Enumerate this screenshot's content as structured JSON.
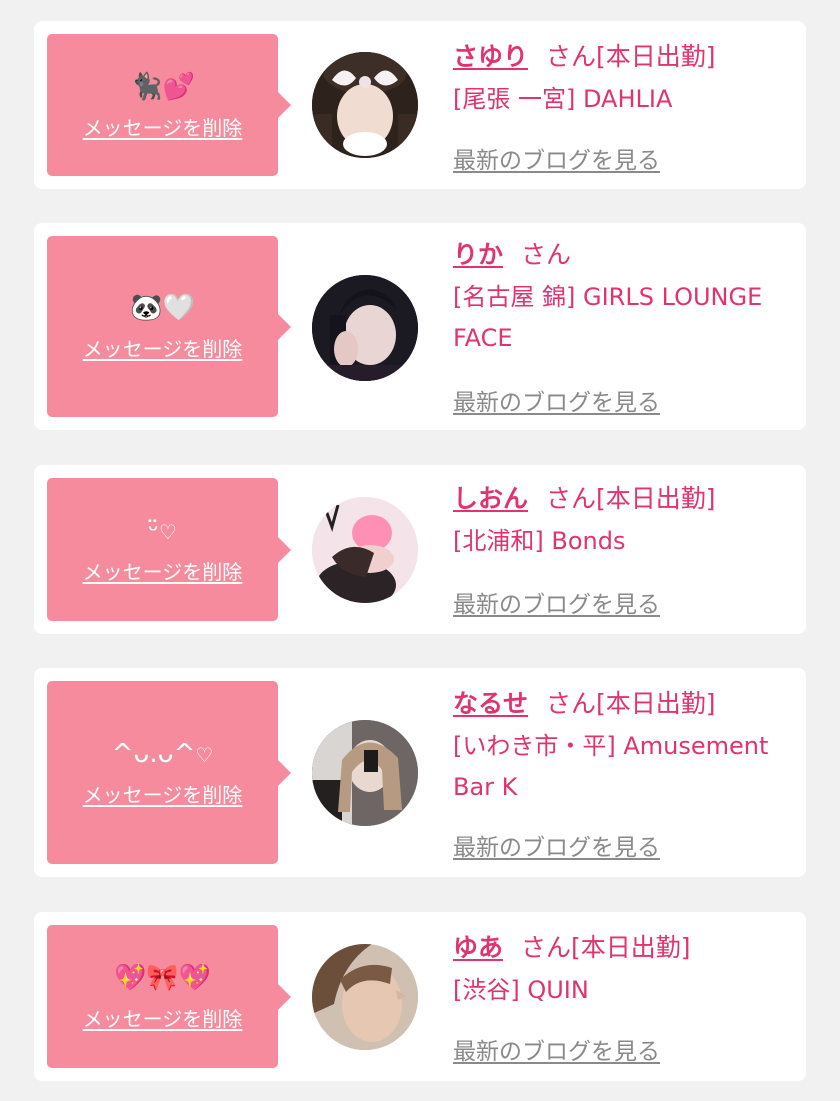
{
  "delete_label": "メッセージを削除",
  "blog_label": "最新のブログを見る",
  "san_suffix": "さん",
  "entries": [
    {
      "emoji": [
        "🐈‍⬛",
        "💕"
      ],
      "name": "さゆり",
      "status": "[本日出勤]",
      "shop": "[尾張 一宮] DAHLIA"
    },
    {
      "emoji": [
        "🐼",
        "🤍"
      ],
      "name": "りか",
      "status": "",
      "shop": "[名古屋 錦] GIRLS LOUNGE FACE"
    },
    {
      "emoji": [
        "ᵕ̈",
        "♡"
      ],
      "name": "しおん",
      "status": "[本日出勤]",
      "shop": "[北浦和] Bonds"
    },
    {
      "emoji": [
        "^ᴗ.ᴗ^",
        "♡"
      ],
      "name": "なるせ",
      "status": "[本日出勤]",
      "shop": "[いわき市・平] Amusement Bar K"
    },
    {
      "emoji": [
        "💖",
        "🎀",
        "💖"
      ],
      "name": "ゆあ",
      "status": "[本日出勤]",
      "shop": "[渋谷] QUIN"
    }
  ],
  "colors": {
    "accent": "#e0336f",
    "bubble": "#f58b9c",
    "background": "#f1f1f1",
    "card": "#ffffff",
    "link_gray": "#8a8a8a"
  }
}
